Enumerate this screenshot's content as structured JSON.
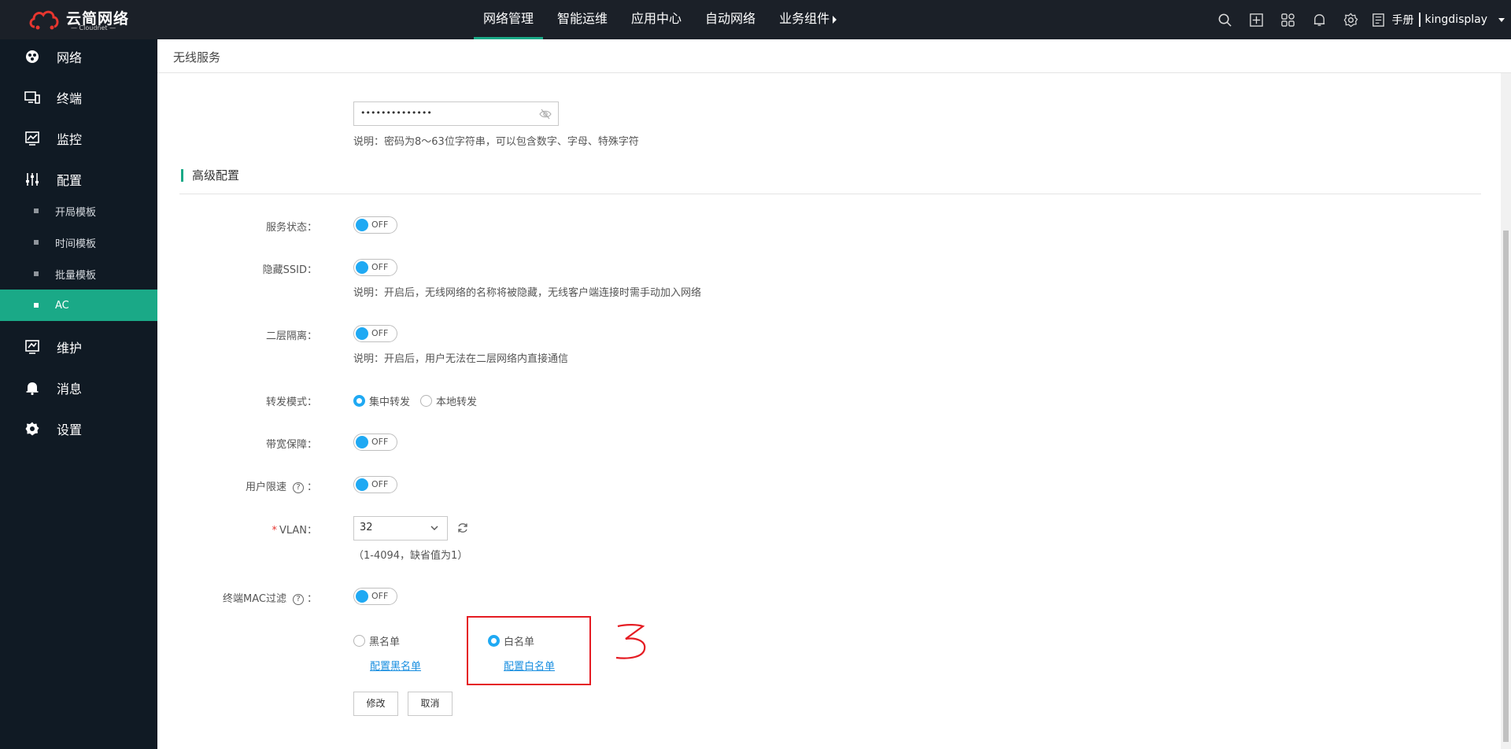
{
  "topbar": {
    "logo_text": "云简网络",
    "logo_sub": "— Cloudnet —",
    "nav": [
      {
        "label": "网络管理",
        "active": true
      },
      {
        "label": "智能运维",
        "active": false
      },
      {
        "label": "应用中心",
        "active": false
      },
      {
        "label": "自动网络",
        "active": false
      },
      {
        "label": "业务组件",
        "active": false
      }
    ],
    "tool_icons": [
      "search-icon",
      "add-icon",
      "apps-grid-icon",
      "bell-icon",
      "gear-icon",
      "manual-icon"
    ],
    "manual_label": "手册",
    "user": "kingdisplay"
  },
  "sidebar": {
    "items": [
      {
        "label": "网络",
        "icon": "network-icon"
      },
      {
        "label": "终端",
        "icon": "terminal-icon"
      },
      {
        "label": "监控",
        "icon": "monitor-icon"
      },
      {
        "label": "配置",
        "icon": "config-icon"
      },
      {
        "label": "维护",
        "icon": "maintenance-icon"
      },
      {
        "label": "消息",
        "icon": "message-bell-icon"
      },
      {
        "label": "设置",
        "icon": "settings-icon"
      }
    ],
    "sub_items": [
      {
        "label": "开局模板",
        "active": false
      },
      {
        "label": "时间模板",
        "active": false
      },
      {
        "label": "批量模板",
        "active": false
      },
      {
        "label": "AC",
        "active": true
      }
    ]
  },
  "breadcrumb": "无线服务",
  "form": {
    "password_value": "••••••••••••••",
    "password_note": "说明：密码为8～63位字符串，可以包含数字、字母、特殊字符",
    "section_title": "高级配置",
    "service_status": {
      "label": "服务状态：",
      "state": "OFF"
    },
    "hide_ssid": {
      "label": "隐藏SSID：",
      "state": "OFF",
      "note": "说明：开启后，无线网络的名称将被隐藏，无线客户端连接时需手动加入网络"
    },
    "layer2_isolation": {
      "label": "二层隔离：",
      "state": "OFF",
      "note": "说明：开启后，用户无法在二层网络内直接通信"
    },
    "forward_mode": {
      "label": "转发模式：",
      "options": [
        "集中转发",
        "本地转发"
      ],
      "selected": "集中转发"
    },
    "bandwidth": {
      "label": "带宽保障：",
      "state": "OFF"
    },
    "user_rate_limit": {
      "label": "用户限速",
      "suffix": "：",
      "state": "OFF"
    },
    "vlan": {
      "label": "VLAN：",
      "value": "32",
      "note": "（1-4094，缺省值为1）"
    },
    "mac_filter": {
      "label": "终端MAC过滤",
      "suffix": "：",
      "state": "OFF"
    },
    "blacklist": {
      "label": "黑名单",
      "link": "配置黑名单"
    },
    "whitelist": {
      "label": "白名单",
      "link": "配置白名单"
    },
    "buttons": {
      "modify": "修改",
      "cancel": "取消"
    }
  },
  "annotation": {
    "number": "3",
    "color": "#e51c23"
  },
  "colors": {
    "accent": "#1aa987",
    "toggle_blue": "#1fa9f3",
    "link": "#1a8fe0",
    "sidebar_bg": "#101a24",
    "topbar_bg": "#1b2028"
  }
}
